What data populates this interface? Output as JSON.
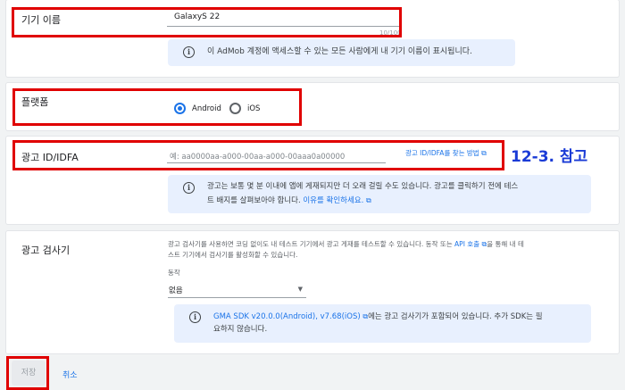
{
  "device_name": {
    "label": "기기 이름",
    "value": "GalaxyS 22",
    "counter": "10/100",
    "info": "이 AdMob 계정에 액세스할 수 있는 모든 사람에게 내 기기 이름이 표시됩니다."
  },
  "platform": {
    "label": "플랫폼",
    "options": [
      "Android",
      "iOS"
    ],
    "selected": "Android"
  },
  "ad_id": {
    "label": "광고 ID/IDFA",
    "placeholder": "예: aa0000aa-a000-00aa-a000-00aaa0a00000",
    "help_link": "광고 ID/IDFA를 찾는 방법",
    "annotation": "12-3. 참고",
    "info_line1": "광고는 보통 몇 분 이내에 앱에 게재되지만 더 오래 걸릴 수도 있습니다. 광고를 클릭하기 전에 테스",
    "info_line2_prefix": "트 배지를 살펴보아야 합니다. ",
    "info_link": "이유를 확인하세요."
  },
  "inspector": {
    "label": "광고 검사기",
    "desc_line1_prefix": "광고 검사기를 사용하면 코딩 없이도 내 테스트 기기에서 광고 게재를 테스트할 수 있습니다. 동작 또는 ",
    "desc_link": "API 호출",
    "desc_line1_suffix": "을 통해 내 테",
    "desc_line2": "스트 기기에서 검사기를 활성화할 수 있습니다.",
    "behavior_label": "동작",
    "behavior_value": "없음",
    "sdk_link": "GMA SDK v20.0.0(Android), v7.68(iOS)",
    "sdk_line1_suffix": "에는 광고 검사기가 포함되어 있습니다. 추가 SDK는 필",
    "sdk_line2": "요하지 않습니다."
  },
  "actions": {
    "save": "저장",
    "cancel": "취소"
  },
  "colors": {
    "accent": "#1a73e8",
    "highlight": "#e00000",
    "annotation": "#1a3bd6"
  }
}
